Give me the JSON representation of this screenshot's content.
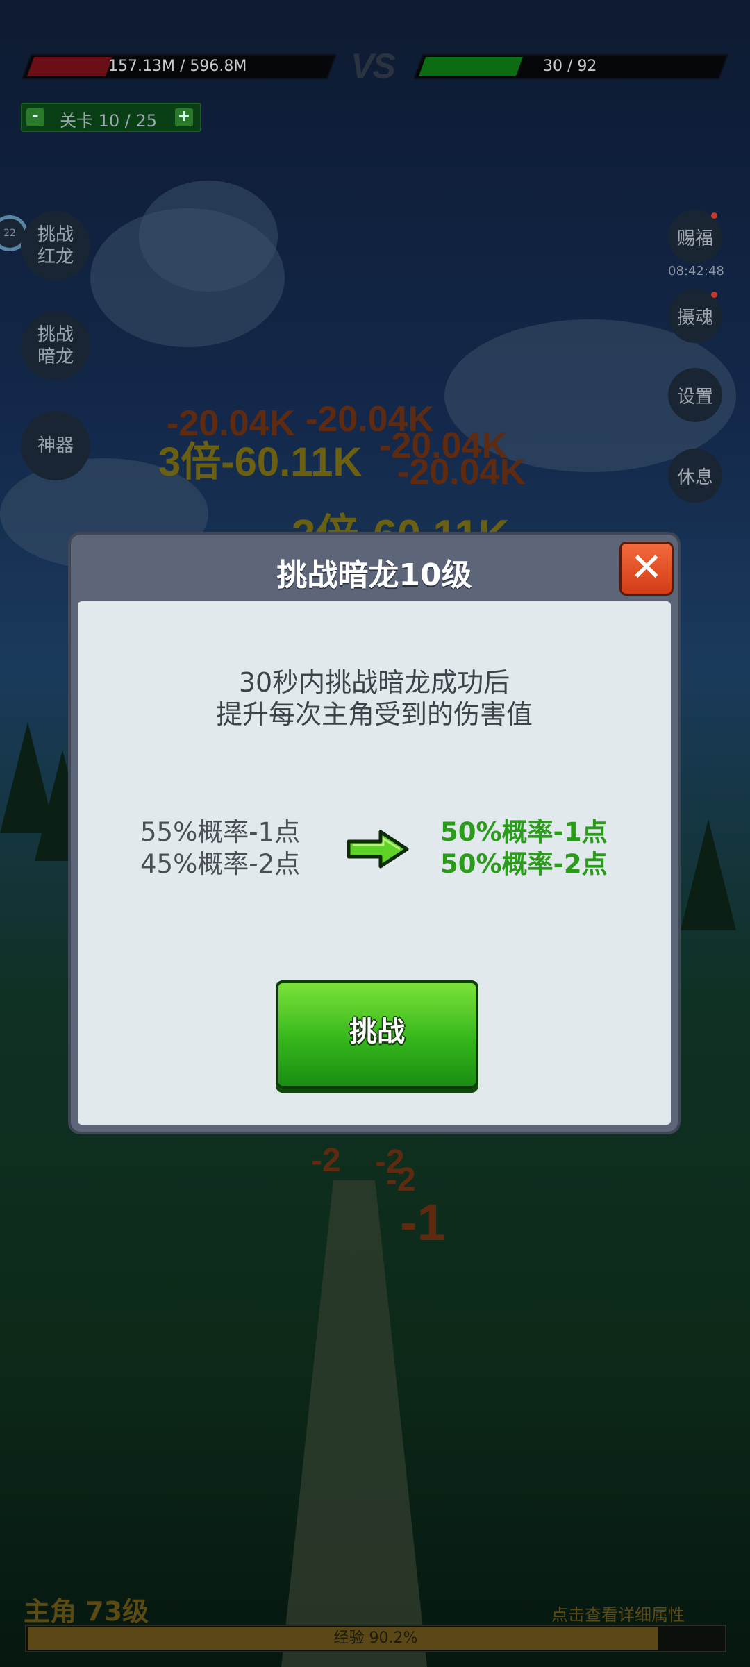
{
  "colors": {
    "modal_header": "#5d6678",
    "modal_body": "#e1e9ed",
    "accent_green": "#2b9b1b",
    "button_green": "#35b61b",
    "close_red": "#e04a22",
    "player_hp": "#6b0f16",
    "enemy_hp": "#0d6b13"
  },
  "hud": {
    "player_hp_text": "157.13M / 596.8M",
    "player_hp_fraction": 0.263,
    "vs_label": "VS",
    "enemy_hp_text": "30 / 92",
    "enemy_hp_fraction": 0.326,
    "level_minus": "-",
    "level_label": "关卡 10 / 25",
    "level_plus": "+"
  },
  "left_menu": {
    "edge_badge": "22",
    "items": [
      "挑战\n红龙",
      "挑战\n暗龙",
      "神器"
    ]
  },
  "right_menu": {
    "items": [
      "赐福",
      "摄魂",
      "设置",
      "休息"
    ],
    "timer": "08:42:48"
  },
  "damage_numbers": {
    "a": "-20.04K",
    "b": "-20.04K",
    "c": "3倍-60.11K",
    "d": "-20.04K",
    "e": "-20.04K",
    "f": "3倍-60.11K",
    "g": "-2",
    "h": "-2",
    "i": "-2",
    "j": "-1"
  },
  "modal": {
    "title": "挑战暗龙10级",
    "close_icon": "✕",
    "description_line1": "30秒内挑战暗龙成功后",
    "description_line2": "提升每次主角受到的伤害值",
    "current_line1": "55%概率-1点",
    "current_line2": "45%概率-2点",
    "arrow_icon": "arrow-right-icon",
    "next_line1": "50%概率-1点",
    "next_line2": "50%概率-2点",
    "challenge_button": "挑战"
  },
  "footer": {
    "hero_level": "主角 73级",
    "details_link": "点击查看详细属性",
    "xp_text": "经验 90.2%",
    "xp_fraction": 0.902
  }
}
